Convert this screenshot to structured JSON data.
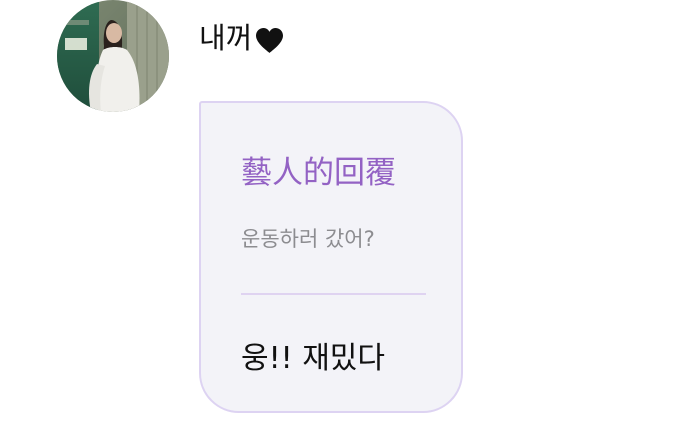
{
  "sender": {
    "name": "내꺼",
    "icon": "heart-icon",
    "heart_color": "#111111"
  },
  "reply_card": {
    "header": "藝人的回覆",
    "quoted_message": "운동하러 갔어?",
    "reply_message": "웅!! 재밌다",
    "accent_color": "#9362c4",
    "background_color": "#f3f3f8",
    "border_color": "#ddd3f2"
  }
}
